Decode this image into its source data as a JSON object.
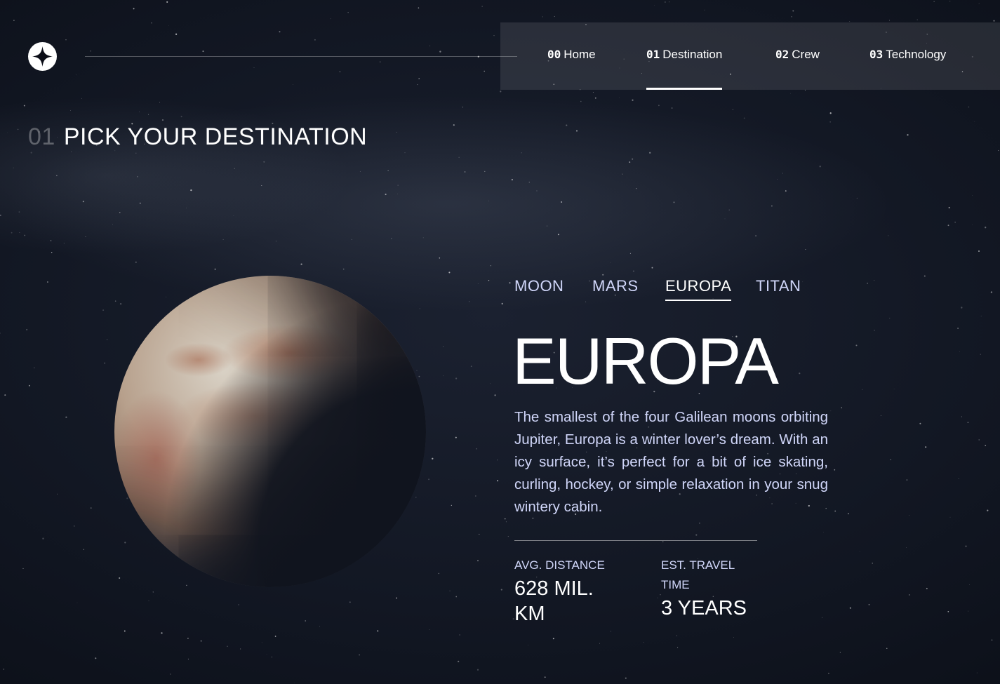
{
  "nav": {
    "items": [
      {
        "num": "00",
        "label": "Home"
      },
      {
        "num": "01",
        "label": "Destination"
      },
      {
        "num": "02",
        "label": "Crew"
      },
      {
        "num": "03",
        "label": "Technology"
      }
    ],
    "active_index": 1
  },
  "page": {
    "title_index": "01",
    "title": "PICK YOUR DESTINATION"
  },
  "destination": {
    "tabs": [
      "MOON",
      "MARS",
      "EUROPA",
      "TITAN"
    ],
    "active_tab": "EUROPA",
    "name": "EUROPA",
    "description": "The smallest of the four Galilean moons orbiting Jupiter, Europa is a winter lover’s dream. With an icy surface, it’s perfect for a bit of ice skating, curling, hockey, or simple relaxation in your snug wintery cabin.",
    "stats": {
      "distance_label": "AVG. DISTANCE",
      "distance_value": "628 MIL. KM",
      "travel_label": "EST. TRAVEL TIME",
      "travel_value": "3 YEARS"
    }
  },
  "icons": {
    "logo": "star-logo-icon"
  },
  "colors": {
    "background": "#121723",
    "accent_text": "#d0d6f9",
    "white": "#ffffff"
  }
}
